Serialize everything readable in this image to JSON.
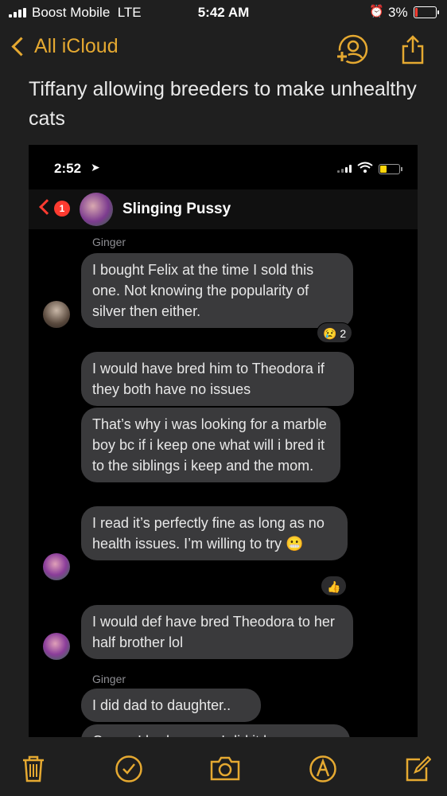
{
  "status_bar": {
    "carrier": "Boost Mobile",
    "network": "LTE",
    "time": "5:42 AM",
    "battery": "3%"
  },
  "nav": {
    "back_label": "All iCloud",
    "icons": [
      "add-person-icon",
      "share-icon"
    ]
  },
  "note": {
    "title": "Tiffany allowing breeders to make unhealthy cats"
  },
  "screenshot": {
    "status_time": "2:52",
    "header": {
      "badge": "1",
      "group_name": "Slinging Pussy"
    },
    "senders": [
      "Ginger",
      "Ginger"
    ],
    "messages": [
      "I bought Felix at the time I sold this one. Not knowing the popularity of silver then either.",
      "I would have bred him to Theodora if they both have no issues",
      "That’s why i was looking for a marble boy bc if i keep one what will i bred it to the siblings i keep and the mom.",
      "I read it’s perfectly fine as long as no health issues. I’m willing to try 😬",
      "I would def have bred Theodora to her half brother lol",
      "I did dad to daughter..",
      "Cause I had no one I did it because"
    ],
    "reactions": [
      {
        "emoji": "😢",
        "count": "2"
      },
      {
        "emoji": "👍",
        "count": ""
      }
    ]
  },
  "toolbar": {
    "icons": [
      "trash-icon",
      "checklist-icon",
      "camera-icon",
      "markup-icon",
      "compose-icon"
    ]
  },
  "colors": {
    "accent": "#e5a931",
    "bubble": "#3a3a3c",
    "badge": "#ff3b30"
  }
}
